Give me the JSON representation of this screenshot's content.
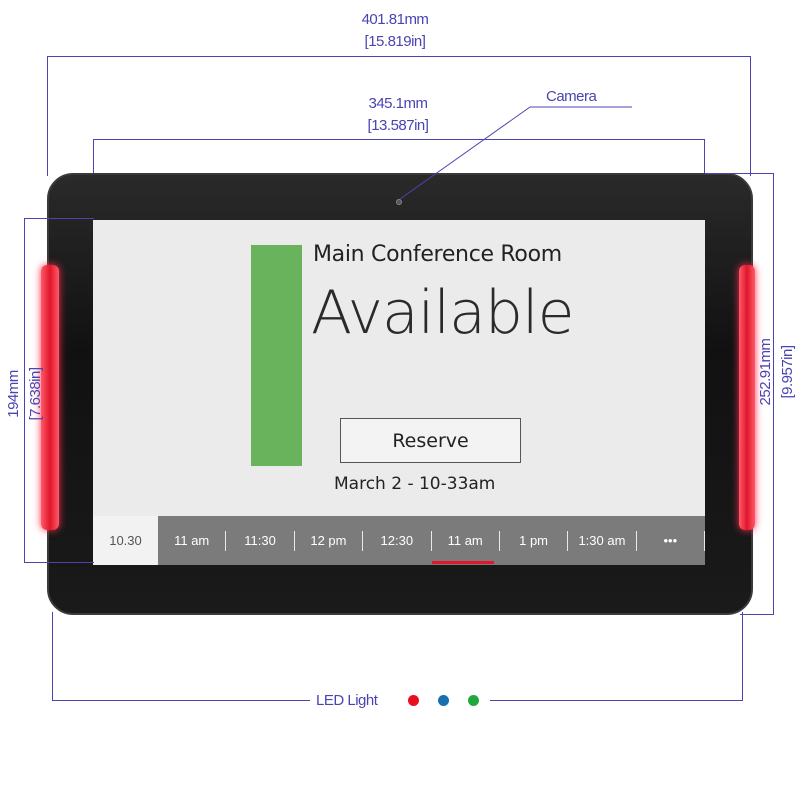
{
  "dimensions": {
    "outer_width": {
      "mm": "401.81mm",
      "in": "[15.819in]"
    },
    "screen_width": {
      "mm": "345.1mm",
      "in": "[13.587in]"
    },
    "screen_height": {
      "mm": "194mm",
      "in": "[7.638in]"
    },
    "outer_height": {
      "mm": "252.91mm",
      "in": "[9.957in]"
    }
  },
  "labels": {
    "camera": "Camera",
    "led_light": "LED Light"
  },
  "led_colors": [
    "#e8101e",
    "#1a6fb0",
    "#22a83a"
  ],
  "screen": {
    "room_name": "Main Conference Room",
    "status": "Available",
    "status_color": "#69b35c",
    "reserve_label": "Reserve",
    "date_time": "March 2 - 10-33am",
    "current_time": "10.30",
    "time_slots": [
      "11 am",
      "11:30",
      "12 pm",
      "12:30",
      "11 am",
      "1 pm",
      "1:30 am",
      "•••"
    ],
    "selected_slot": "12:30"
  }
}
